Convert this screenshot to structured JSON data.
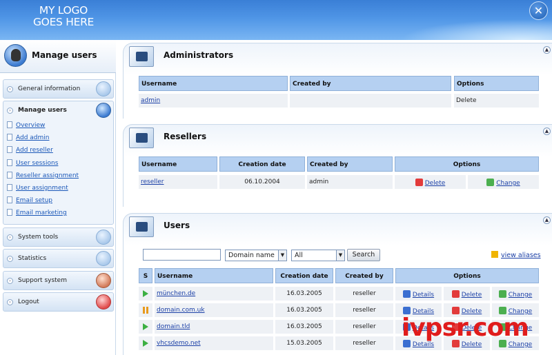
{
  "header": {
    "logo_line1": "MY LOGO",
    "logo_line2": "GOES HERE",
    "close_glyph": "✕"
  },
  "sidebar": {
    "title": "Manage users",
    "sections": {
      "general_information": "General information",
      "manage_users": "Manage users",
      "system_tools": "System tools",
      "statistics": "Statistics",
      "support_system": "Support system",
      "logout": "Logout"
    },
    "links": [
      "Overview",
      "Add admin",
      "Add reseller",
      "User sessions",
      "Reseller assignment",
      "User assignment",
      "Email setup",
      "Email marketing"
    ]
  },
  "administrators": {
    "title": "Administrators",
    "headers": {
      "username": "Username",
      "created_by": "Created by",
      "options": "Options"
    },
    "rows": [
      {
        "username": "admin",
        "created_by": "",
        "option": "Delete"
      }
    ]
  },
  "resellers": {
    "title": "Resellers",
    "headers": {
      "username": "Username",
      "creation_date": "Creation date",
      "created_by": "Created by",
      "options": "Options"
    },
    "rows": [
      {
        "username": "reseller",
        "creation_date": "06.10.2004",
        "created_by": "admin",
        "delete": "Delete",
        "change": "Change"
      }
    ]
  },
  "users": {
    "title": "Users",
    "search": {
      "query": "",
      "field": "Domain name",
      "scope": "All",
      "button": "Search"
    },
    "view_aliases": "view aliases",
    "headers": {
      "s": "S",
      "username": "Username",
      "creation_date": "Creation date",
      "created_by": "Created by",
      "options": "Options"
    },
    "rows": [
      {
        "status": "active",
        "username": "münchen.de",
        "creation_date": "16.03.2005",
        "created_by": "reseller",
        "details": "Details",
        "delete": "Delete",
        "change": "Change"
      },
      {
        "status": "suspended",
        "username": "domain.com.uk",
        "creation_date": "16.03.2005",
        "created_by": "reseller",
        "details": "Details",
        "delete": "Delete",
        "change": "Change"
      },
      {
        "status": "active",
        "username": "domain.tld",
        "creation_date": "16.03.2005",
        "created_by": "reseller",
        "details": "Details",
        "delete": "Delete",
        "change": "Change"
      },
      {
        "status": "active",
        "username": "vhcsdemo.net",
        "creation_date": "15.03.2005",
        "created_by": "reseller",
        "details": "Details",
        "delete": "Delete",
        "change": "Change"
      }
    ]
  },
  "watermark": "ivpsr.com",
  "colors": {
    "header_blue": "#3a7fd6",
    "table_header": "#b5d0f1",
    "link": "#1a3fa6",
    "watermark_red": "#e01c1c"
  }
}
